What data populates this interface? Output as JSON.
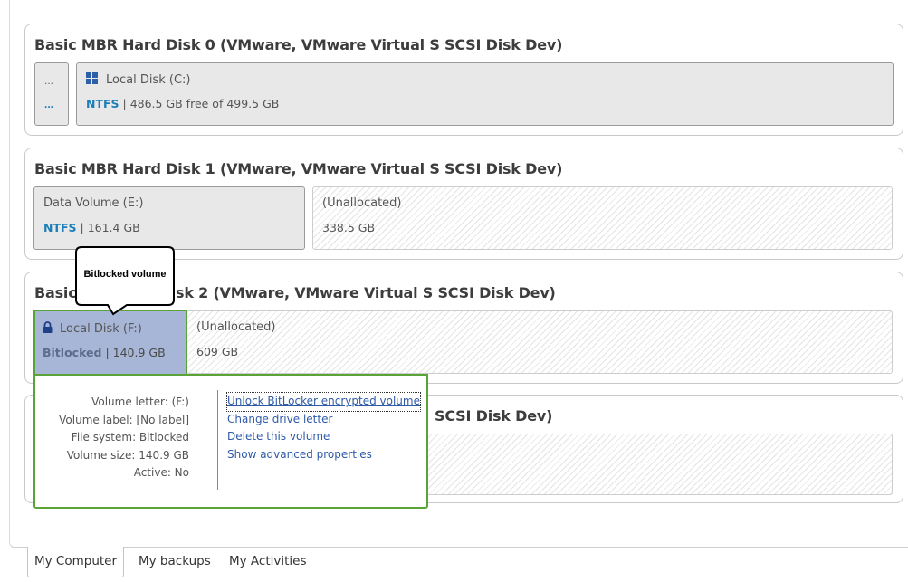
{
  "disks": [
    {
      "title": "Basic MBR Hard Disk 0 (VMware, VMware Virtual S SCSI Disk Dev)",
      "small_part": {
        "top": "...",
        "bottom": "..."
      },
      "partitions": [
        {
          "label": "Local Disk (C:)",
          "fs": "NTFS",
          "info": " | 486.5 GB free of 499.5 GB",
          "icon": "windows-icon"
        }
      ]
    },
    {
      "title": "Basic MBR Hard Disk 1 (VMware, VMware Virtual S SCSI Disk Dev)",
      "partitions": [
        {
          "label": "Data Volume (E:)",
          "fs": "NTFS",
          "info": " | 161.4 GB"
        },
        {
          "label": "(Unallocated)",
          "info": "338.5 GB"
        }
      ]
    },
    {
      "title_left": "Basic",
      "title_right": "sk 2 (VMware, VMware Virtual S SCSI Disk Dev)",
      "partitions": [
        {
          "label": "Local Disk (F:)",
          "fs": "Bitlocked",
          "info": " | 140.9 GB",
          "icon": "lock-icon"
        },
        {
          "label": "(Unallocated)",
          "info": "609 GB"
        }
      ]
    },
    {
      "title_right": "SCSI Disk Dev)"
    }
  ],
  "callout": {
    "text": "Bitlocked volume"
  },
  "popup": {
    "props": [
      "Volume letter: (F:)",
      "Volume label: [No label]",
      "File system: Bitlocked",
      "Volume size: 140.9 GB",
      "Active: No"
    ],
    "actions": [
      "Unlock BitLocker encrypted volume",
      "Change drive letter",
      "Delete this volume",
      "Show advanced properties"
    ]
  },
  "tabs": [
    "My Computer",
    "My backups",
    "My Activities"
  ],
  "colors": {
    "accent_green": "#5aa339",
    "fs_blue": "#1a7fb8",
    "bitlocked_bg": "#a7b6d6",
    "link": "#2e5aa8"
  }
}
